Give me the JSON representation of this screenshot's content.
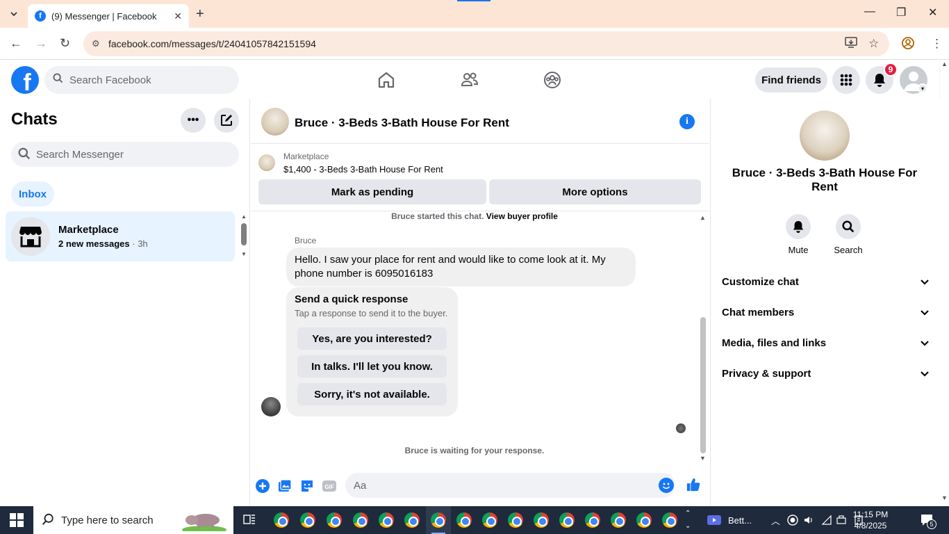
{
  "browser": {
    "tab_title": "(9) Messenger | Facebook",
    "tab_favicon": "f",
    "url": "facebook.com/messages/t/24041057842151594"
  },
  "fb_header": {
    "search_placeholder": "Search Facebook",
    "find_friends": "Find friends",
    "notification_count": "9"
  },
  "chats": {
    "title": "Chats",
    "search_placeholder": "Search Messenger",
    "filter": "Inbox",
    "items": [
      {
        "name": "Marketplace",
        "preview": "2 new messages",
        "time": "3h"
      }
    ]
  },
  "conversation": {
    "title": "Bruce · 3-Beds 3-Bath House For Rent",
    "marketplace_label": "Marketplace",
    "listing": "$1,400 - 3-Beds 3-Bath House For Rent",
    "mark_pending": "Mark as pending",
    "more_options": "More options",
    "started_text": "Bruce started this chat.",
    "view_profile": "View buyer profile",
    "sender": "Bruce",
    "message": "Hello. I saw your place for rent and would like to come look at it. My phone number is 6095016183",
    "quick_title": "Send a quick response",
    "quick_sub": "Tap a response to send it to the buyer.",
    "quick_responses": [
      "Yes, are you interested?",
      "In talks. I'll let you know.",
      "Sorry, it's not available."
    ],
    "waiting": "Bruce is waiting for your response.",
    "composer_placeholder": "Aa"
  },
  "details": {
    "name": "Bruce · 3-Beds 3-Bath House For Rent",
    "actions": [
      "Mute",
      "Search"
    ],
    "sections": [
      "Customize chat",
      "Chat members",
      "Media, files and links",
      "Privacy & support"
    ]
  },
  "taskbar": {
    "search_placeholder": "Type here to search",
    "app_label": "Bett...",
    "time": "11:15 PM",
    "date": "4/8/2025",
    "notif_count": "5"
  },
  "colors": {
    "accent": "#1877f2",
    "badge": "#e41e3f",
    "taskbar": "#1f2a3c",
    "tabbar": "#fde5d6"
  }
}
